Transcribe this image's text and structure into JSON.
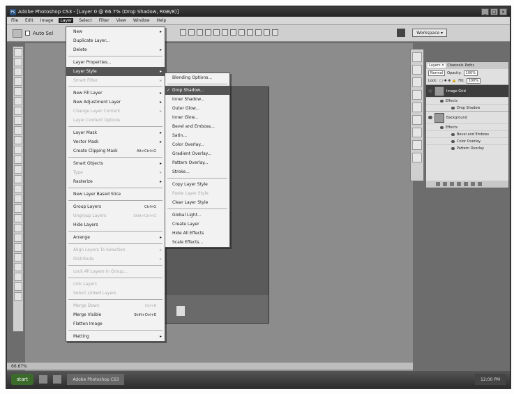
{
  "window": {
    "title": "Adobe Photoshop CS3 - [Layer 0 @ 66.7% (Drop Shadow, RGB/8)]"
  },
  "menubar": [
    {
      "label": "File",
      "active": false
    },
    {
      "label": "Edit",
      "active": false
    },
    {
      "label": "Image",
      "active": false
    },
    {
      "label": "Layer",
      "active": true
    },
    {
      "label": "Select",
      "active": false
    },
    {
      "label": "Filter",
      "active": false
    },
    {
      "label": "View",
      "active": false
    },
    {
      "label": "Window",
      "active": false
    },
    {
      "label": "Help",
      "active": false
    }
  ],
  "optionsbar": {
    "autoselect": "Auto Sel",
    "workspace": "Workspace ▾"
  },
  "layer_menu": [
    {
      "label": "New",
      "arrow": true
    },
    {
      "label": "Duplicate Layer..."
    },
    {
      "label": "Delete",
      "arrow": true
    },
    {
      "sep": true
    },
    {
      "label": "Layer Properties..."
    },
    {
      "label": "Layer Style",
      "arrow": true,
      "hl": true
    },
    {
      "label": "Smart Filter",
      "arrow": true,
      "disabled": true
    },
    {
      "sep": true
    },
    {
      "label": "New Fill Layer",
      "arrow": true
    },
    {
      "label": "New Adjustment Layer",
      "arrow": true
    },
    {
      "label": "Change Layer Content",
      "arrow": true,
      "disabled": true
    },
    {
      "label": "Layer Content Options",
      "disabled": true
    },
    {
      "sep": true
    },
    {
      "label": "Layer Mask",
      "arrow": true
    },
    {
      "label": "Vector Mask",
      "arrow": true
    },
    {
      "label": "Create Clipping Mask",
      "sc": "Alt+Ctrl+G"
    },
    {
      "sep": true
    },
    {
      "label": "Smart Objects",
      "arrow": true
    },
    {
      "label": "Type",
      "arrow": true,
      "disabled": true
    },
    {
      "label": "Rasterize",
      "arrow": true
    },
    {
      "sep": true
    },
    {
      "label": "New Layer Based Slice"
    },
    {
      "sep": true
    },
    {
      "label": "Group Layers",
      "sc": "Ctrl+G"
    },
    {
      "label": "Ungroup Layers",
      "sc": "Shift+Ctrl+G",
      "disabled": true
    },
    {
      "label": "Hide Layers"
    },
    {
      "sep": true
    },
    {
      "label": "Arrange",
      "arrow": true
    },
    {
      "sep": true
    },
    {
      "label": "Align Layers To Selection",
      "arrow": true,
      "disabled": true
    },
    {
      "label": "Distribute",
      "arrow": true,
      "disabled": true
    },
    {
      "sep": true
    },
    {
      "label": "Lock All Layers in Group...",
      "disabled": true
    },
    {
      "sep": true
    },
    {
      "label": "Link Layers",
      "disabled": true
    },
    {
      "label": "Select Linked Layers",
      "disabled": true
    },
    {
      "sep": true
    },
    {
      "label": "Merge Down",
      "sc": "Ctrl+E",
      "disabled": true
    },
    {
      "label": "Merge Visible",
      "sc": "Shift+Ctrl+E"
    },
    {
      "label": "Flatten Image"
    },
    {
      "sep": true
    },
    {
      "label": "Matting",
      "arrow": true
    }
  ],
  "style_submenu": [
    {
      "label": "Blending Options..."
    },
    {
      "sep": true
    },
    {
      "label": "Drop Shadow...",
      "hl": true,
      "check": true
    },
    {
      "label": "Inner Shadow..."
    },
    {
      "label": "Outer Glow..."
    },
    {
      "label": "Inner Glow..."
    },
    {
      "label": "Bevel and Emboss..."
    },
    {
      "label": "Satin..."
    },
    {
      "label": "Color Overlay..."
    },
    {
      "label": "Gradient Overlay..."
    },
    {
      "label": "Pattern Overlay..."
    },
    {
      "label": "Stroke..."
    },
    {
      "sep": true
    },
    {
      "label": "Copy Layer Style"
    },
    {
      "label": "Paste Layer Style",
      "disabled": true
    },
    {
      "label": "Clear Layer Style"
    },
    {
      "sep": true
    },
    {
      "label": "Global Light..."
    },
    {
      "label": "Create Layer"
    },
    {
      "label": "Hide All Effects"
    },
    {
      "label": "Scale Effects..."
    }
  ],
  "layers_panel": {
    "tabs": [
      "Layers ×",
      "Channels",
      "Paths"
    ],
    "blend_mode": "Normal",
    "opacity_label": "Opacity:",
    "opacity": "100%",
    "lock_label": "Lock:",
    "fill_label": "Fill:",
    "fill": "100%",
    "layers": [
      {
        "name": "Image Grid",
        "selected": true,
        "effects": [
          "Effects",
          "Drop Shadow"
        ]
      },
      {
        "name": "Background",
        "selected": false,
        "effects": [
          "Effects",
          "Bevel and Emboss",
          "Color Overlay",
          "Pattern Overlay"
        ]
      }
    ]
  },
  "statusbar": {
    "zoom": "66.67%"
  },
  "taskbar": {
    "start": "start",
    "app": "Adobe Photoshop CS3",
    "tray": "12:00 PM"
  }
}
